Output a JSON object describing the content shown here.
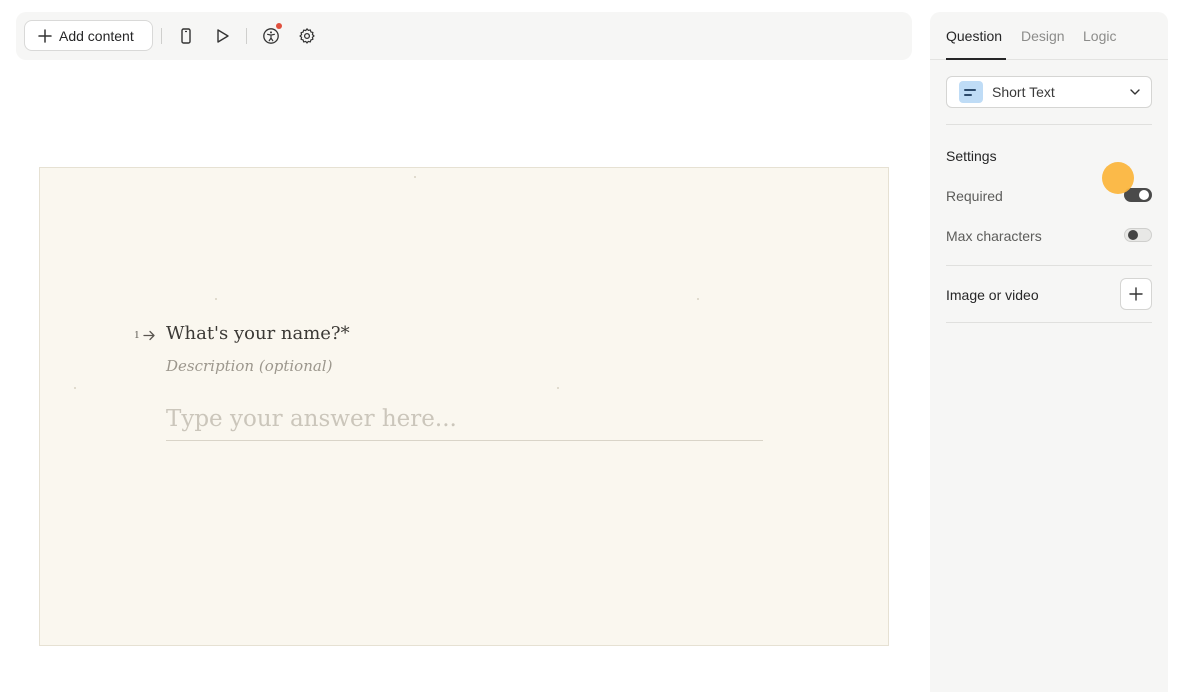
{
  "toolbar": {
    "add_content_label": "Add content",
    "icons": [
      "plus-icon",
      "mobile-preview-icon",
      "play-icon",
      "accessibility-icon",
      "gear-icon"
    ]
  },
  "question": {
    "number": "1",
    "title": "What's your name?*",
    "description_placeholder": "Description (optional)",
    "answer_placeholder": "Type your answer here..."
  },
  "panel": {
    "tabs": [
      {
        "label": "Question",
        "active": true
      },
      {
        "label": "Design",
        "active": false
      },
      {
        "label": "Logic",
        "active": false
      }
    ],
    "question_type": "Short Text",
    "settings_heading": "Settings",
    "required_label": "Required",
    "required_on": true,
    "max_characters_label": "Max characters",
    "max_characters_on": false,
    "image_video_label": "Image or video"
  },
  "colors": {
    "preview_background": "#faf7ef",
    "panel_background": "#f6f6f5",
    "notification_dot": "#e0503e",
    "question_type_icon": "#bfdcf6",
    "cursor_highlight": "#fbb43a"
  }
}
